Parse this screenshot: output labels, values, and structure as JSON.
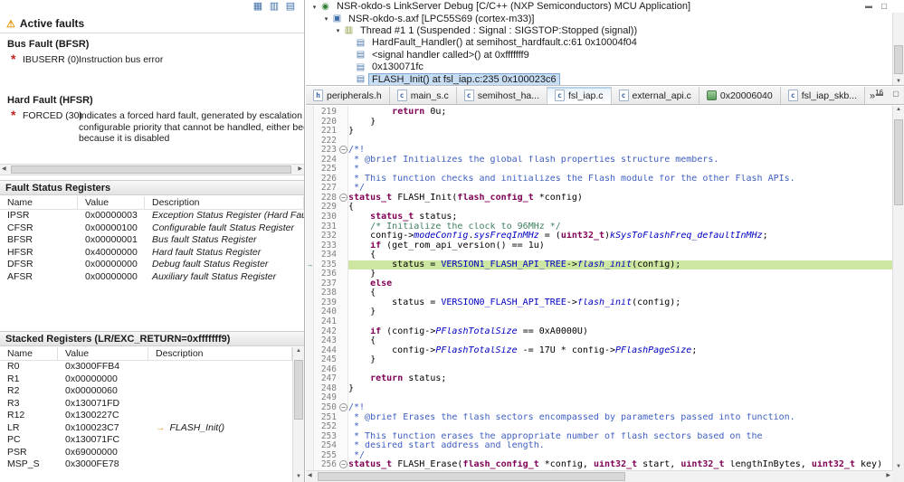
{
  "left_toolbar": {
    "icons": [
      {
        "name": "table-view-icon",
        "glyph": "▦"
      },
      {
        "name": "split-view-icon",
        "glyph": "▥"
      },
      {
        "name": "grid-view-icon",
        "glyph": "▤"
      }
    ]
  },
  "faults_view": {
    "title": "Active faults",
    "sections": [
      {
        "title": "Bus Fault (BFSR)",
        "items": [
          {
            "name": "IBUSERR (0)",
            "description_lines": [
              "Instruction bus error"
            ]
          }
        ]
      },
      {
        "title": "Hard Fault (HFSR)",
        "items": [
          {
            "name": "FORCED (30)",
            "description_lines": [
              "Indicates a forced hard fault, generated by escalation of a fault wit",
              "configurable priority that cannot be handled, either because of prio",
              "because it is disabled"
            ]
          }
        ]
      }
    ]
  },
  "fault_registers": {
    "title": "Fault Status Registers",
    "columns": [
      "Name",
      "Value",
      "Description"
    ],
    "rows": [
      {
        "name": "IPSR",
        "value": "0x00000003",
        "description": "Exception Status Register (Hard Fault)"
      },
      {
        "name": "CFSR",
        "value": "0x00000100",
        "description": "Configurable fault Status Register"
      },
      {
        "name": "BFSR",
        "value": "0x00000001",
        "description": "Bus fault Status Register"
      },
      {
        "name": "HFSR",
        "value": "0x40000000",
        "description": "Hard fault Status Register"
      },
      {
        "name": "DFSR",
        "value": "0x00000000",
        "description": "Debug fault Status Register"
      },
      {
        "name": "AFSR",
        "value": "0x00000000",
        "description": "Auxiliary fault Status Register"
      }
    ]
  },
  "stacked_registers": {
    "title": "Stacked Registers (LR/EXC_RETURN=0xfffffff9)",
    "columns": [
      "Name",
      "Value",
      "Description"
    ],
    "rows": [
      {
        "name": "R0",
        "value": "0x3000FFB4",
        "description": ""
      },
      {
        "name": "R1",
        "value": "0x00000000",
        "description": ""
      },
      {
        "name": "R2",
        "value": "0x00000060",
        "description": ""
      },
      {
        "name": "R3",
        "value": "0x130071FD",
        "description": ""
      },
      {
        "name": "R12",
        "value": "0x1300227C",
        "description": ""
      },
      {
        "name": "LR",
        "value": "0x100023C7",
        "description": "FLASH_Init()",
        "arrow": true
      },
      {
        "name": "PC",
        "value": "0x130071FC",
        "description": ""
      },
      {
        "name": "PSR",
        "value": "0x69000000",
        "description": ""
      },
      {
        "name": "MSP_S",
        "value": "0x3000FE78",
        "description": ""
      }
    ]
  },
  "debug_view": {
    "rows": [
      {
        "indent": 0,
        "expanded": true,
        "icon": "debug-target-icon",
        "label": "NSR-okdo-s LinkServer Debug [C/C++ (NXP Semiconductors) MCU Application]"
      },
      {
        "indent": 1,
        "expanded": true,
        "icon": "program-icon",
        "label": "NSR-okdo-s.axf [LPC55S69 (cortex-m33)]"
      },
      {
        "indent": 2,
        "expanded": true,
        "icon": "thread-icon",
        "label": "Thread #1 1 (Suspended : Signal : SIGSTOP:Stopped (signal))"
      },
      {
        "indent": 3,
        "icon": "stack-frame-icon",
        "label": "HardFault_Handler() at semihost_hardfault.c:61 0x10004f04"
      },
      {
        "indent": 3,
        "icon": "stack-frame-icon",
        "label": "<signal handler called>() at 0xfffffff9"
      },
      {
        "indent": 3,
        "icon": "stack-frame-icon",
        "label": "0x130071fc"
      },
      {
        "indent": 3,
        "icon": "stack-frame-icon",
        "label": "FLASH_Init() at fsl_iap.c:235 0x100023c6",
        "selected": true
      }
    ]
  },
  "editor": {
    "tabs": [
      {
        "label": "peripherals.h",
        "icon": "h-file-icon",
        "glyph": "h"
      },
      {
        "label": "main_s.c",
        "icon": "c-file-icon",
        "glyph": "c"
      },
      {
        "label": "semihost_ha...",
        "icon": "c-file-icon",
        "glyph": "c"
      },
      {
        "label": "fsl_iap.c",
        "icon": "c-file-icon",
        "glyph": "c",
        "selected": true
      },
      {
        "label": "external_api.c",
        "icon": "c-file-icon",
        "glyph": "c"
      },
      {
        "label": "0x20006040",
        "icon": "memory-icon",
        "glyph": ""
      },
      {
        "label": "fsl_iap_skb...",
        "icon": "c-file-icon",
        "glyph": "c"
      }
    ],
    "hidden_tabs_chevron": "»",
    "hidden_tabs_count": "16",
    "code": {
      "current_line": 235,
      "fold_lines": [
        223,
        228,
        250,
        256
      ],
      "lines": [
        {
          "n": 219,
          "s": [
            [
              "p",
              "        "
            ],
            [
              "k",
              "return"
            ],
            [
              "p",
              " 0u;"
            ]
          ]
        },
        {
          "n": 220,
          "s": [
            [
              "p",
              "    }"
            ]
          ]
        },
        {
          "n": 221,
          "s": [
            [
              "p",
              "}"
            ]
          ]
        },
        {
          "n": 222,
          "s": [
            [
              "p",
              ""
            ]
          ]
        },
        {
          "n": 223,
          "s": [
            [
              "dc",
              "/*!"
            ]
          ]
        },
        {
          "n": 224,
          "s": [
            [
              "dc",
              " * @brief Initializes the global flash properties structure members."
            ]
          ]
        },
        {
          "n": 225,
          "s": [
            [
              "dc",
              " *"
            ]
          ]
        },
        {
          "n": 226,
          "s": [
            [
              "dc",
              " * This function checks and initializes the Flash module for the other Flash APIs."
            ]
          ]
        },
        {
          "n": 227,
          "s": [
            [
              "dc",
              " */"
            ]
          ]
        },
        {
          "n": 228,
          "s": [
            [
              "t",
              "status_t"
            ],
            [
              "p",
              " FLASH_Init("
            ],
            [
              "t",
              "flash_config_t"
            ],
            [
              "p",
              " *config)"
            ]
          ]
        },
        {
          "n": 229,
          "s": [
            [
              "p",
              "{"
            ]
          ]
        },
        {
          "n": 230,
          "s": [
            [
              "p",
              "    "
            ],
            [
              "t",
              "status_t"
            ],
            [
              "p",
              " status;"
            ]
          ]
        },
        {
          "n": 231,
          "s": [
            [
              "p",
              "    "
            ],
            [
              "c",
              "/* Initialize the clock to 96MHz */"
            ]
          ]
        },
        {
          "n": 232,
          "s": [
            [
              "p",
              "    config->"
            ],
            [
              "m",
              "modeConfig"
            ],
            [
              "p",
              "."
            ],
            [
              "m",
              "sysFreqInMHz"
            ],
            [
              "p",
              " = ("
            ],
            [
              "t",
              "uint32_t"
            ],
            [
              "p",
              ")"
            ],
            [
              "e",
              "kSysToFlashFreq_defaultInMHz"
            ],
            [
              "p",
              ";"
            ]
          ]
        },
        {
          "n": 233,
          "s": [
            [
              "p",
              "    "
            ],
            [
              "k",
              "if"
            ],
            [
              "p",
              " (get_rom_api_version() == 1u)"
            ]
          ]
        },
        {
          "n": 234,
          "s": [
            [
              "p",
              "    {"
            ]
          ]
        },
        {
          "n": 235,
          "s": [
            [
              "p",
              "        status = "
            ],
            [
              "x",
              "VERSION1_FLASH_API_TREE"
            ],
            [
              "p",
              "->"
            ],
            [
              "m",
              "flash_init"
            ],
            [
              "p",
              "(config);"
            ]
          ]
        },
        {
          "n": 236,
          "s": [
            [
              "p",
              "    }"
            ]
          ]
        },
        {
          "n": 237,
          "s": [
            [
              "p",
              "    "
            ],
            [
              "k",
              "else"
            ]
          ]
        },
        {
          "n": 238,
          "s": [
            [
              "p",
              "    {"
            ]
          ]
        },
        {
          "n": 239,
          "s": [
            [
              "p",
              "        status = "
            ],
            [
              "x",
              "VERSION0_FLASH_API_TREE"
            ],
            [
              "p",
              "->"
            ],
            [
              "m",
              "flash_init"
            ],
            [
              "p",
              "(config);"
            ]
          ]
        },
        {
          "n": 240,
          "s": [
            [
              "p",
              "    }"
            ]
          ]
        },
        {
          "n": 241,
          "s": [
            [
              "p",
              ""
            ]
          ]
        },
        {
          "n": 242,
          "s": [
            [
              "p",
              "    "
            ],
            [
              "k",
              "if"
            ],
            [
              "p",
              " (config->"
            ],
            [
              "m",
              "PFlashTotalSize"
            ],
            [
              "p",
              " == 0xA0000U)"
            ]
          ]
        },
        {
          "n": 243,
          "s": [
            [
              "p",
              "    {"
            ]
          ]
        },
        {
          "n": 244,
          "s": [
            [
              "p",
              "        config->"
            ],
            [
              "m",
              "PFlashTotalSize"
            ],
            [
              "p",
              " -= 17U * config->"
            ],
            [
              "m",
              "PFlashPageSize"
            ],
            [
              "p",
              ";"
            ]
          ]
        },
        {
          "n": 245,
          "s": [
            [
              "p",
              "    }"
            ]
          ]
        },
        {
          "n": 246,
          "s": [
            [
              "p",
              ""
            ]
          ]
        },
        {
          "n": 247,
          "s": [
            [
              "p",
              "    "
            ],
            [
              "k",
              "return"
            ],
            [
              "p",
              " status;"
            ]
          ]
        },
        {
          "n": 248,
          "s": [
            [
              "p",
              "}"
            ]
          ]
        },
        {
          "n": 249,
          "s": [
            [
              "p",
              ""
            ]
          ]
        },
        {
          "n": 250,
          "s": [
            [
              "dc",
              "/*!"
            ]
          ]
        },
        {
          "n": 251,
          "s": [
            [
              "dc",
              " * @brief Erases the flash sectors encompassed by parameters passed into function."
            ]
          ]
        },
        {
          "n": 252,
          "s": [
            [
              "dc",
              " *"
            ]
          ]
        },
        {
          "n": 253,
          "s": [
            [
              "dc",
              " * This function erases the appropriate number of flash sectors based on the"
            ]
          ]
        },
        {
          "n": 254,
          "s": [
            [
              "dc",
              " * desired start address and length."
            ]
          ]
        },
        {
          "n": 255,
          "s": [
            [
              "dc",
              " */"
            ]
          ]
        },
        {
          "n": 256,
          "s": [
            [
              "t",
              "status_t"
            ],
            [
              "p",
              " FLASH_Erase("
            ],
            [
              "t",
              "flash_config_t"
            ],
            [
              "p",
              " *config, "
            ],
            [
              "t",
              "uint32_t"
            ],
            [
              "p",
              " start, "
            ],
            [
              "t",
              "uint32_t"
            ],
            [
              "p",
              " lengthInBytes, "
            ],
            [
              "t",
              "uint32_t"
            ],
            [
              "p",
              " key)"
            ]
          ]
        }
      ]
    }
  },
  "colors": {
    "selection": "#c6ddf3",
    "current_debug_line": "#cde6a2",
    "keyword": "#7f0055",
    "doc_comment": "#3f5fbf",
    "comment": "#3f7f5f",
    "member": "#0000c0"
  }
}
